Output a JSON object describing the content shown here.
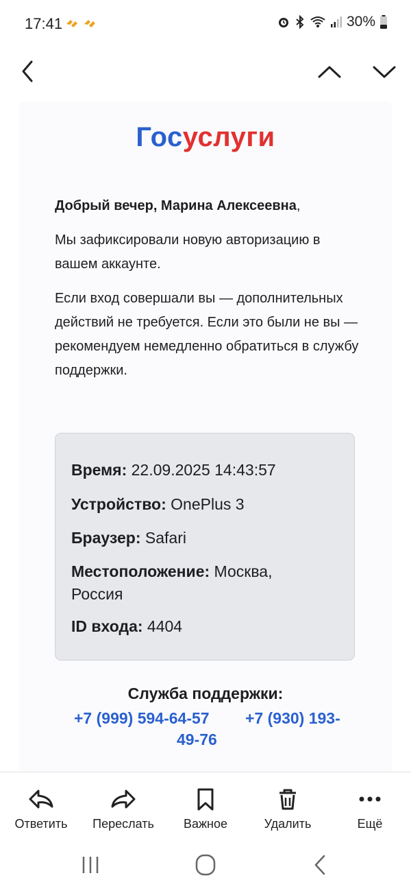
{
  "status_bar": {
    "time": "17:41",
    "battery": "30%",
    "icons": [
      "notification-orange-icon",
      "notification-orange-icon",
      "alarm-icon",
      "bluetooth-icon",
      "wifi-icon",
      "signal-icon",
      "battery-icon"
    ]
  },
  "nav": {
    "icons": [
      "back-chevron-icon",
      "previous-message-icon",
      "next-message-icon"
    ]
  },
  "email": {
    "logo_part1": "Гос",
    "logo_part2": "услуги",
    "greeting_name": "Добрый вечер, Марина Алексеевна",
    "greeting_comma": ",",
    "paragraph1": "Мы зафиксировали новую авторизацию в вашем аккаунте.",
    "paragraph2": "Если вход совершали вы — дополнительных действий не требуется. Если это были не вы — рекомендуем немедленно обратиться в службу поддержки.",
    "details": {
      "time_label": "Время:",
      "time_value": " 22.09.2025 14:43:57",
      "device_label": "Устройство:",
      "device_value": " OnePlus 3",
      "browser_label": "Браузер:",
      "browser_value": " Safari",
      "location_label": "Местоположение:",
      "location_value": " Москва, Россия",
      "login_id_label": "ID входа:",
      "login_id_value": " 4404"
    },
    "support_title": "Служба поддержки:",
    "phone1": "+7 (999) 594-64-57",
    "phone2_line1": "+7 (930) 193-",
    "phone2_line2": "49-76"
  },
  "toolbar": {
    "reply": "Ответить",
    "forward": "Переслать",
    "important": "Важное",
    "delete": "Удалить",
    "more": "Ещё"
  },
  "colors": {
    "brand_blue": "#2a60cf",
    "brand_red": "#e2312f",
    "info_bg": "#e6e8ec"
  }
}
